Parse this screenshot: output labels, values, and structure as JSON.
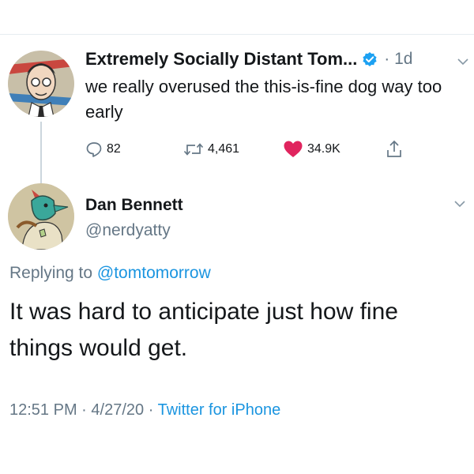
{
  "parent_tweet": {
    "display_name": "Extremely Socially Distant Tom...",
    "separator": "·",
    "age": "1d",
    "text": "we really overused the this-is-fine dog way too early",
    "replies": "82",
    "retweets": "4,461",
    "likes": "34.9K",
    "icons": {
      "reply": "reply-icon",
      "retweet": "retweet-icon",
      "like": "heart-icon",
      "share": "share-icon",
      "verified": "verified-badge-icon",
      "menu": "chevron-down-icon"
    },
    "colors": {
      "like": "#e0245e",
      "verified": "#1da1f2"
    }
  },
  "reply_tweet": {
    "display_name": "Dan Bennett",
    "handle": "@nerdyatty",
    "replying_prefix": "Replying to",
    "replying_to": "@tomtomorrow",
    "text": "It was hard to anticipate just how fine things would get.",
    "time": "12:51 PM",
    "date": "4/27/20",
    "dot": "·",
    "source": "Twitter for iPhone"
  },
  "colors": {
    "link": "#1b95e0",
    "muted": "#657786"
  }
}
